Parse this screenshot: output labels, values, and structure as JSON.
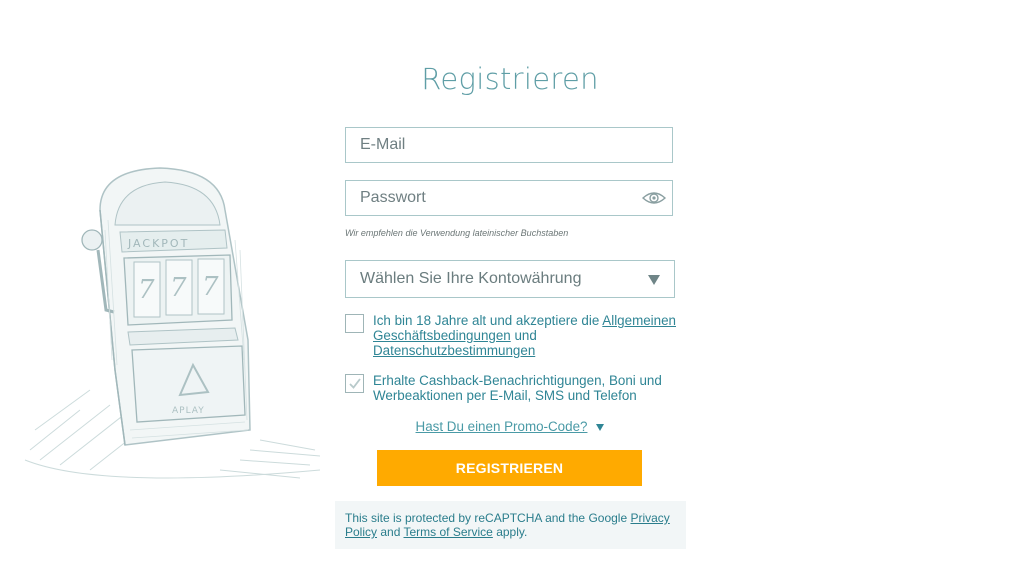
{
  "form": {
    "title": "Registrieren",
    "email_placeholder": "E-Mail",
    "password_placeholder": "Passwort",
    "password_hint": "Wir empfehlen die Verwendung lateinischer Buchstaben",
    "currency_placeholder": "Wählen Sie Ihre Kontowährung",
    "terms": {
      "checked": false,
      "text_before": "Ich bin 18 Jahre alt und akzeptiere die ",
      "link_terms": "Allgemeinen Geschäftsbedingungen",
      "text_mid": " und ",
      "link_privacy": "Datenschutzbestimmungen"
    },
    "marketing": {
      "checked": true,
      "text": "Erhalte Cashback-Benachrichtigungen, Boni und Werbeaktionen per E-Mail, SMS und Telefon"
    },
    "promo_link": "Hast Du einen Promo-Code?",
    "submit_label": "REGISTRIEREN"
  },
  "recaptcha": {
    "text_before": "This site is protected by reCAPTCHA and the Google ",
    "privacy_link": "Privacy Policy",
    "text_mid": " and ",
    "terms_link": "Terms of Service",
    "text_after": " apply."
  },
  "illustration": {
    "jackpot_text": "JACKPOT",
    "reels": [
      "7",
      "7",
      "7"
    ],
    "brand_text": "APLAY"
  },
  "colors": {
    "accent": "#2a7d8c",
    "button": "#ffaa00",
    "border": "#a9c7c9",
    "recaptcha_bg": "#f2f6f7"
  },
  "icons": {
    "password_toggle": "eye-icon",
    "currency_dropdown": "triangle-down-icon",
    "promo_toggle": "caret-down-icon",
    "checkbox_checked": "checkmark-icon"
  }
}
